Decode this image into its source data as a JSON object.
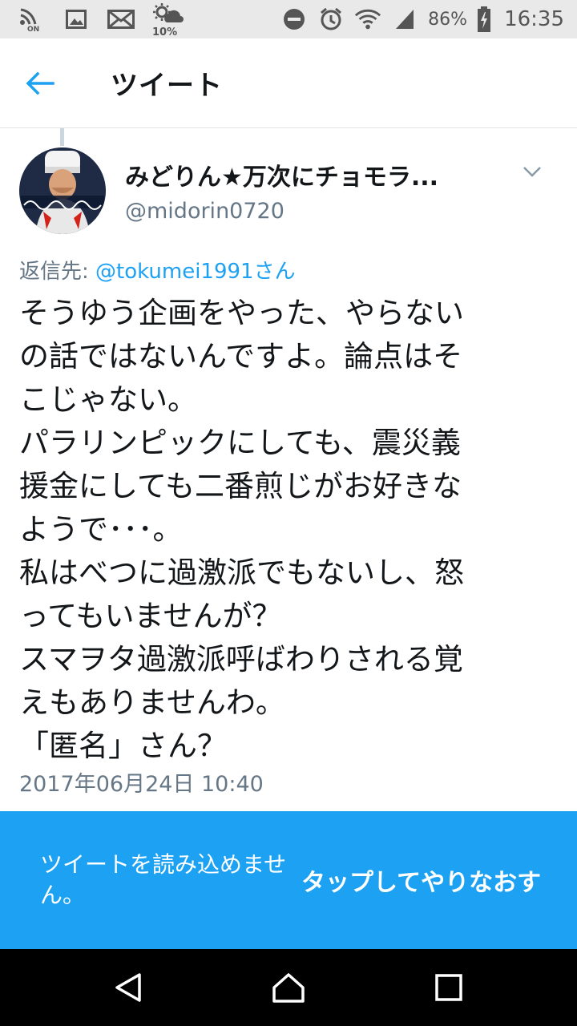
{
  "status_bar": {
    "icons": [
      "nfc-on-icon",
      "image-icon",
      "mail-icon",
      "weather-icon",
      "dnd-icon",
      "alarm-icon",
      "wifi-icon",
      "signal-icon",
      "battery-charging-icon"
    ],
    "nfc_label": "ON",
    "weather_percent": "10%",
    "battery_percent": "86%",
    "time": "16:35"
  },
  "app_bar": {
    "title": "ツイート"
  },
  "tweet": {
    "user_name": "みどりん★万次にチョモラ...",
    "handle": "@midorin0720",
    "reply_prefix": "返信先: ",
    "reply_to": "@tokumei1991さん",
    "lines": [
      "そうゆう企画をやった、やらない",
      "の話ではないんですよ。論点はそ",
      "こじゃない。",
      "パラリンピックにしても、震災義",
      "援金にしても二番煎じがお好きな",
      "ようで･･･。",
      "私はべつに過激派でもないし、怒",
      "ってもいませんが？",
      "スマヲタ過激派呼ばわりされる覚",
      "えもありませんわ。",
      "「匿名」さん？"
    ],
    "timestamp": "2017年06月24日 10:40"
  },
  "error_banner": {
    "message": "ツイートを読み込めません。",
    "retry_label": "タップしてやりなおす"
  },
  "colors": {
    "accent": "#1da1f2",
    "text_primary": "#14171a",
    "text_secondary": "#657786"
  }
}
